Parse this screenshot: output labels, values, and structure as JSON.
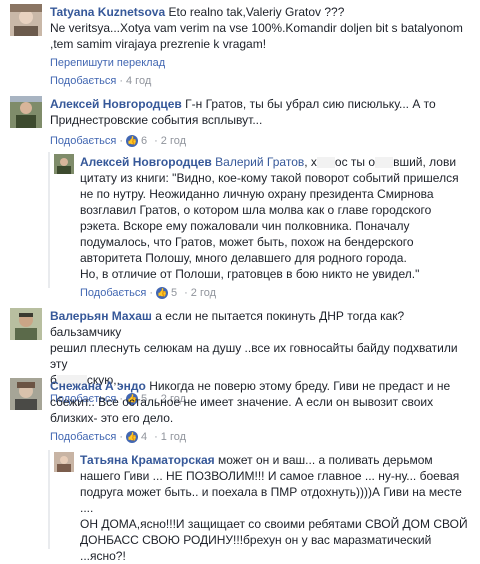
{
  "comments": [
    {
      "author": "Tatyana Kuznetsova",
      "text": "Eto realno tak,Valeriy Gratov ???",
      "text2": "Ne veritsya...Xotya vam verim na vse 100%.Komandir doljen bit s batalyonom",
      "text3": ",tem samim virajaya prezrenie k vragam!",
      "translate": "Перепишути переклад",
      "like": "Подобається",
      "time": "4 год"
    },
    {
      "author": "Алексей Новгородцев",
      "text": "Г-н Гратов, ты бы убрал сию писюльку... А то",
      "text2": "Приднестровские события всплывут...",
      "like": "Подобається",
      "likes": "6",
      "time": "2 год"
    },
    {
      "author": "Алексей Новгородцев",
      "mention": "Валерий Гратов",
      "text": ", х",
      "text_a": "ос ты о",
      "text_b": "вший, лови",
      "lines": [
        "цитату из книги: \"Видно, кое-кому такой поворот событий пришелся",
        "не по нутру. Неожиданно личную охрану президента Смирнова",
        "возглавил Гратов, о котором шла молва как о главе городского",
        "рэкета. Вскоре ему пожаловали чин полковника. Поначалу",
        "подумалось, что Гратов, может быть, похож на бендерского",
        "авторитета Полошу, много делавшего для родного города.",
        "Но, в отличие от Полоши, гратовцев в бою никто не увидел.\""
      ],
      "like": "Подобається",
      "likes": "5",
      "time": "2 год"
    },
    {
      "author": "Валерьян Махаш",
      "text": "а если не пытается покинуть ДНР тогда как? бальзамчику",
      "text2": "решил плеснуть селюкам на душу ..все их говносайты байду подхватили эту",
      "text3a": "б",
      "text3b": "скую,,",
      "like": "Подобається",
      "likes": "5",
      "time": "2 год"
    },
    {
      "author": "Снежана А эндо",
      "text": "Никогда не поверю этому бреду. Гиви не предаст и не",
      "text2": "сбежит.. Все остальное не имеет значение. А если он вывозит своих",
      "text3": "близких- это его дело.",
      "like": "Подобається",
      "likes": "4",
      "time": "1 год"
    },
    {
      "author": "Татьяна Краматорская",
      "text": "может он и ваш... а поливать дерьмом",
      "lines": [
        "нашего Гиви ... НЕ ПОЗВОЛИМ!!! И самое главное ... ну-ну... боевая",
        "подруга может быть.. и поехала в ПМР отдохнуть))))А Гиви на месте ....",
        "ОН ДОМА,ясно!!!И защищает со своими ребятами СВОЙ ДОМ СВОЙ",
        "ДОНБАСС СВОЮ РОДИНУ!!!брехун он у вас маразматический",
        "...ясно?!"
      ]
    }
  ]
}
